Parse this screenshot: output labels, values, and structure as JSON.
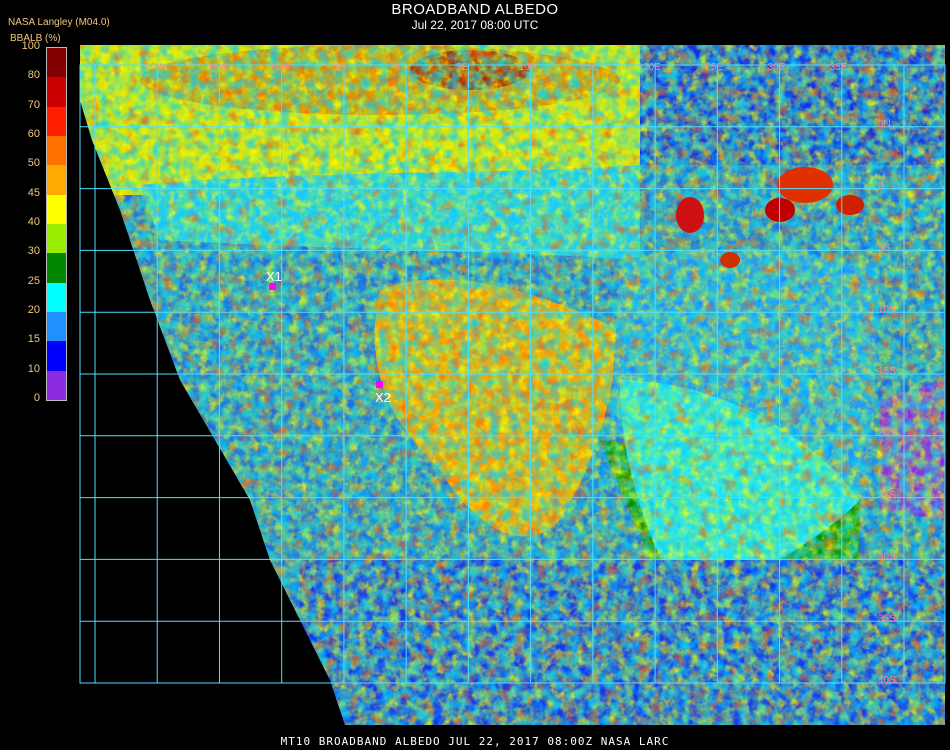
{
  "header": {
    "title": "BROADBAND ALBEDO",
    "subtitle": "Jul 22, 2017 08:00 UTC",
    "credit": "NASA Langley (M04.0)"
  },
  "colorbar": {
    "label": "BBALB (%)",
    "ticks": [
      "100",
      "80",
      "70",
      "60",
      "50",
      "45",
      "40",
      "30",
      "25",
      "20",
      "15",
      "10",
      "0"
    ],
    "colors": [
      "#800000",
      "#cc0000",
      "#ff2000",
      "#ff7000",
      "#ffaa00",
      "#ffff00",
      "#99ee00",
      "#008800",
      "#00ffff",
      "#1e90ff",
      "#0000ff",
      "#8a2be2"
    ]
  },
  "grid": {
    "lon_labels": [
      "20W",
      "15W",
      "10W",
      "5W",
      "0",
      "5E",
      "10E",
      "15E",
      "20E",
      "25E",
      "30E",
      "35E"
    ],
    "lat_labels": [
      "5N",
      "0",
      "5S",
      "10S",
      "15S",
      "20S",
      "25S",
      "30S",
      "35S",
      "40S"
    ]
  },
  "markers": [
    {
      "label": "X1",
      "color": "#ff00ff"
    },
    {
      "label": "X2",
      "color": "#ff00ff"
    }
  ],
  "footer": "MT10  BROADBAND ALBEDO   JUL 22, 2017 08:00Z   NASA LARC"
}
